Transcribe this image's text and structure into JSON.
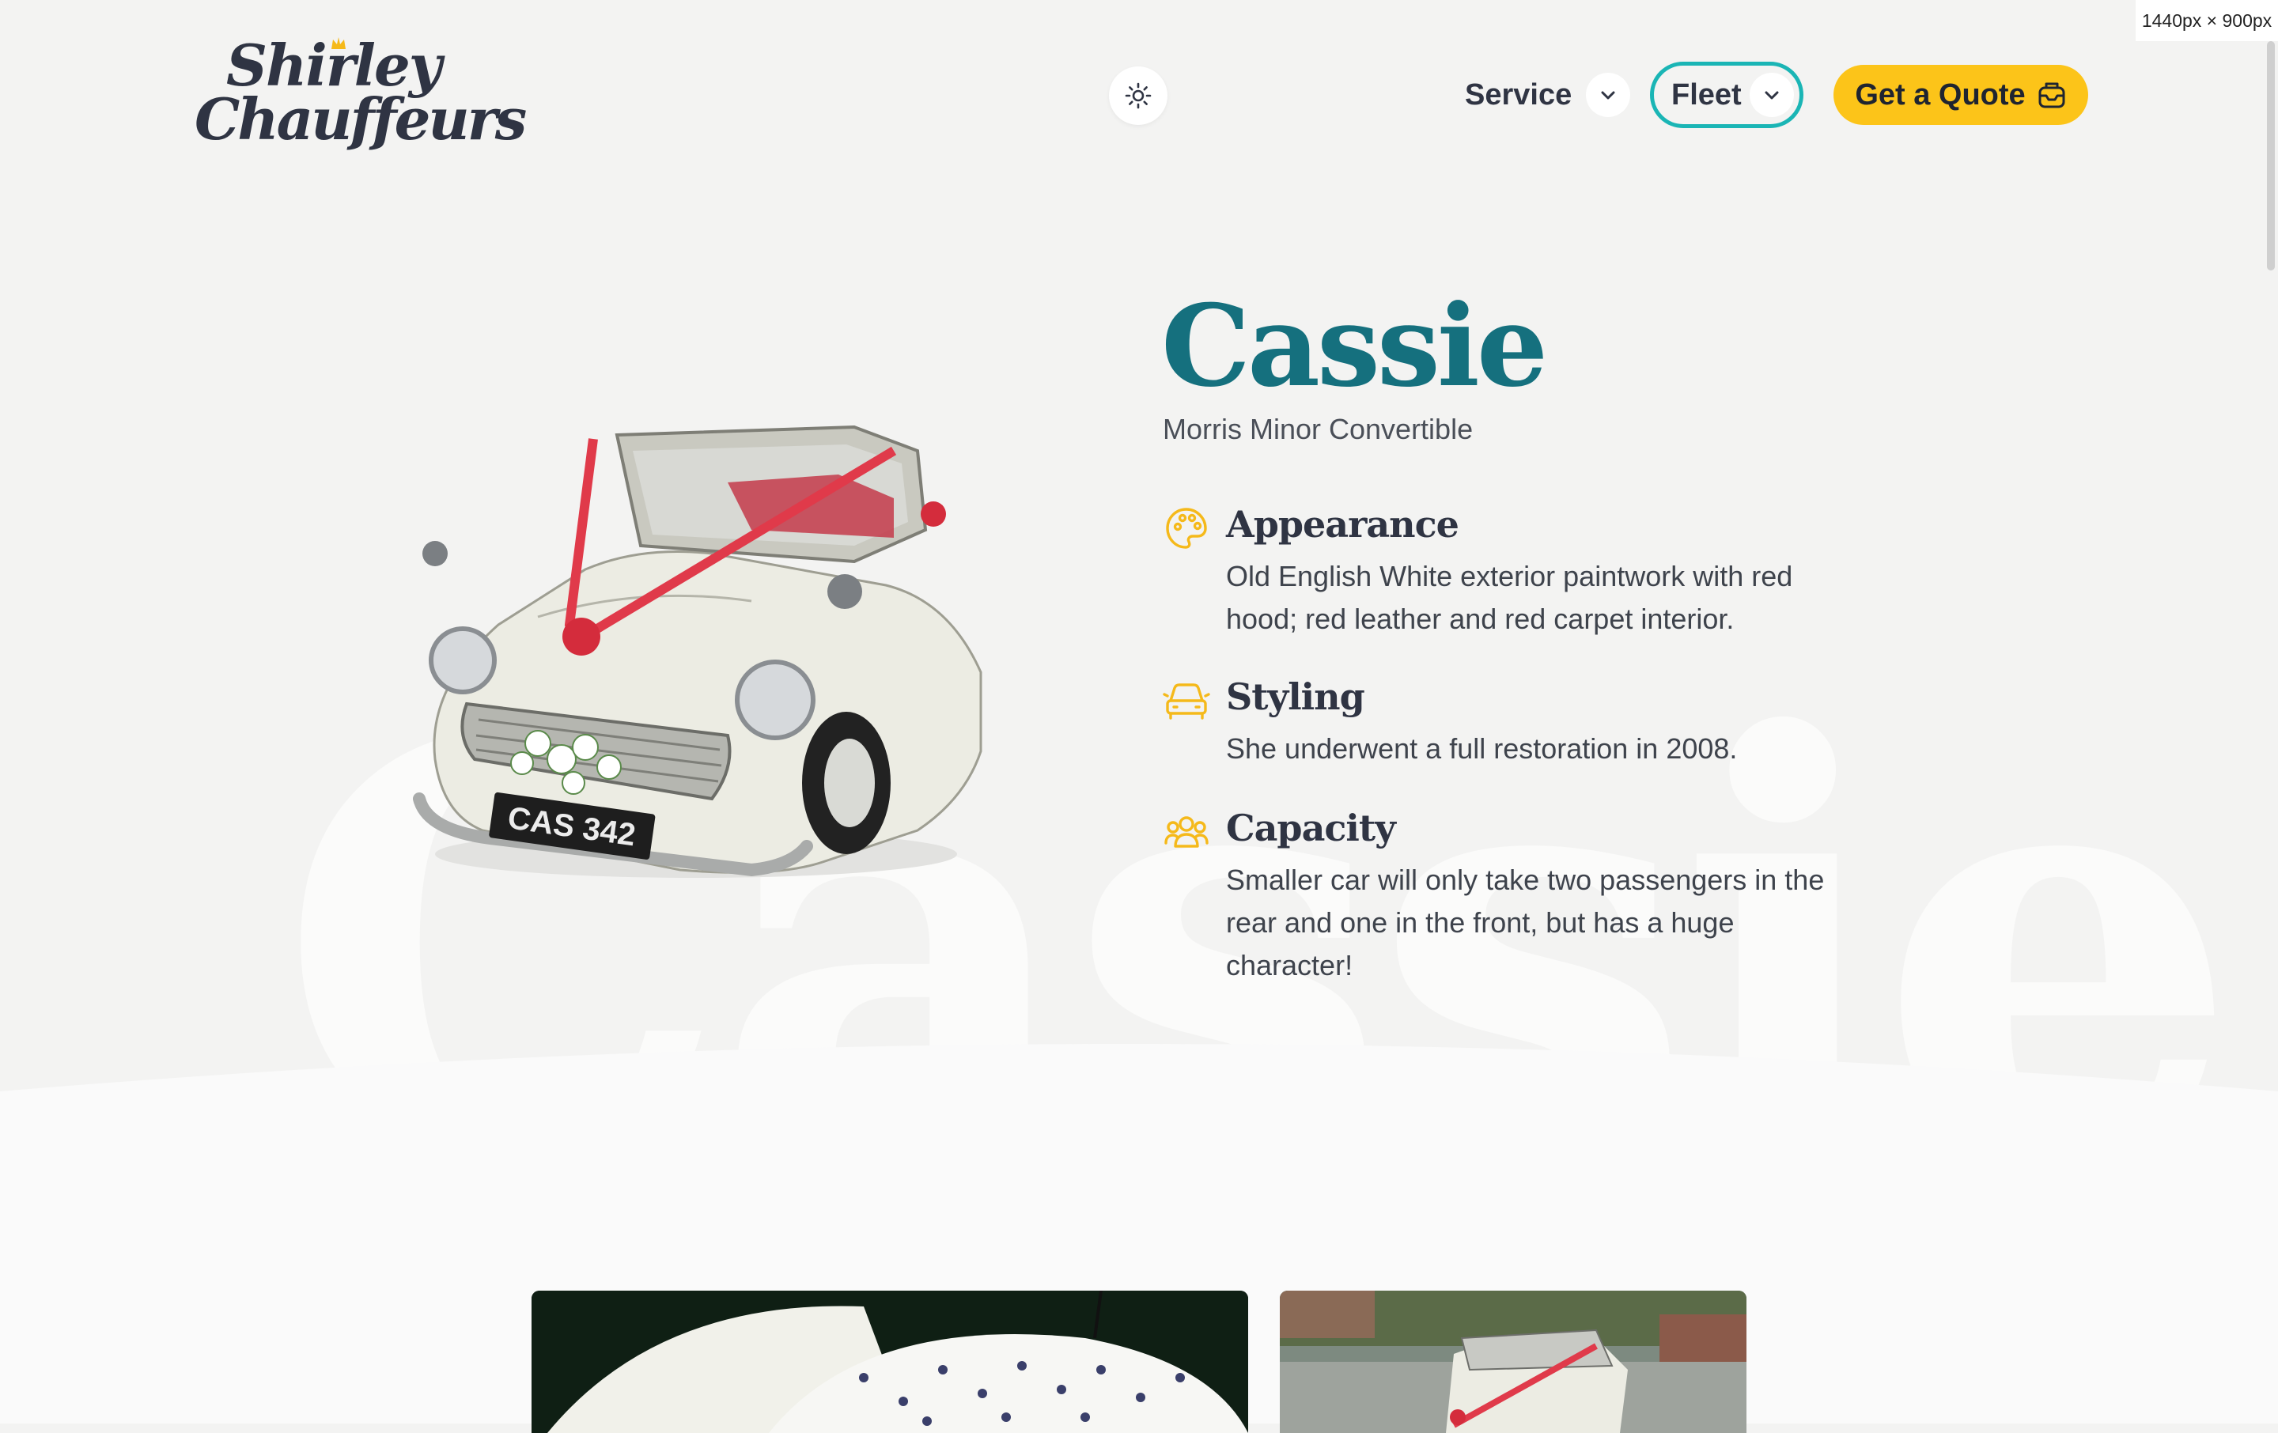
{
  "viewport_label": "1440px × 900px",
  "brand": {
    "line1": "Shirley",
    "line2": "Chauffeurs"
  },
  "nav": {
    "theme_toggle": "sun-icon",
    "items": [
      {
        "label": "Service",
        "icon": "chevron-down-icon"
      },
      {
        "label": "Fleet",
        "icon": "chevron-down-icon",
        "active": true
      }
    ],
    "cta_label": "Get a Quote",
    "cta_icon": "mailbox-icon"
  },
  "vehicle": {
    "name": "Cassie",
    "model": "Morris Minor Convertible",
    "plate": "CAS 342",
    "background_word": "Cassie"
  },
  "features": [
    {
      "icon": "palette-icon",
      "title": "Appearance",
      "text": "Old English White exterior paintwork with red hood; red leather and red carpet interior."
    },
    {
      "icon": "car-icon",
      "title": "Styling",
      "text": "She underwent a full restoration in 2008."
    },
    {
      "icon": "users-icon",
      "title": "Capacity",
      "text": "Smaller car will only take two passengers in the rear and one in the front, but has a huge character!"
    }
  ],
  "colors": {
    "accent_teal": "#15707e",
    "fleet_border": "#1ab5b5",
    "cta_yellow": "#fcc419",
    "icon_yellow": "#f5b91a",
    "background": "#f3f3f2"
  },
  "gallery": [
    {
      "alt": "photo-umbrellas"
    },
    {
      "alt": "photo-car-driveway"
    }
  ]
}
